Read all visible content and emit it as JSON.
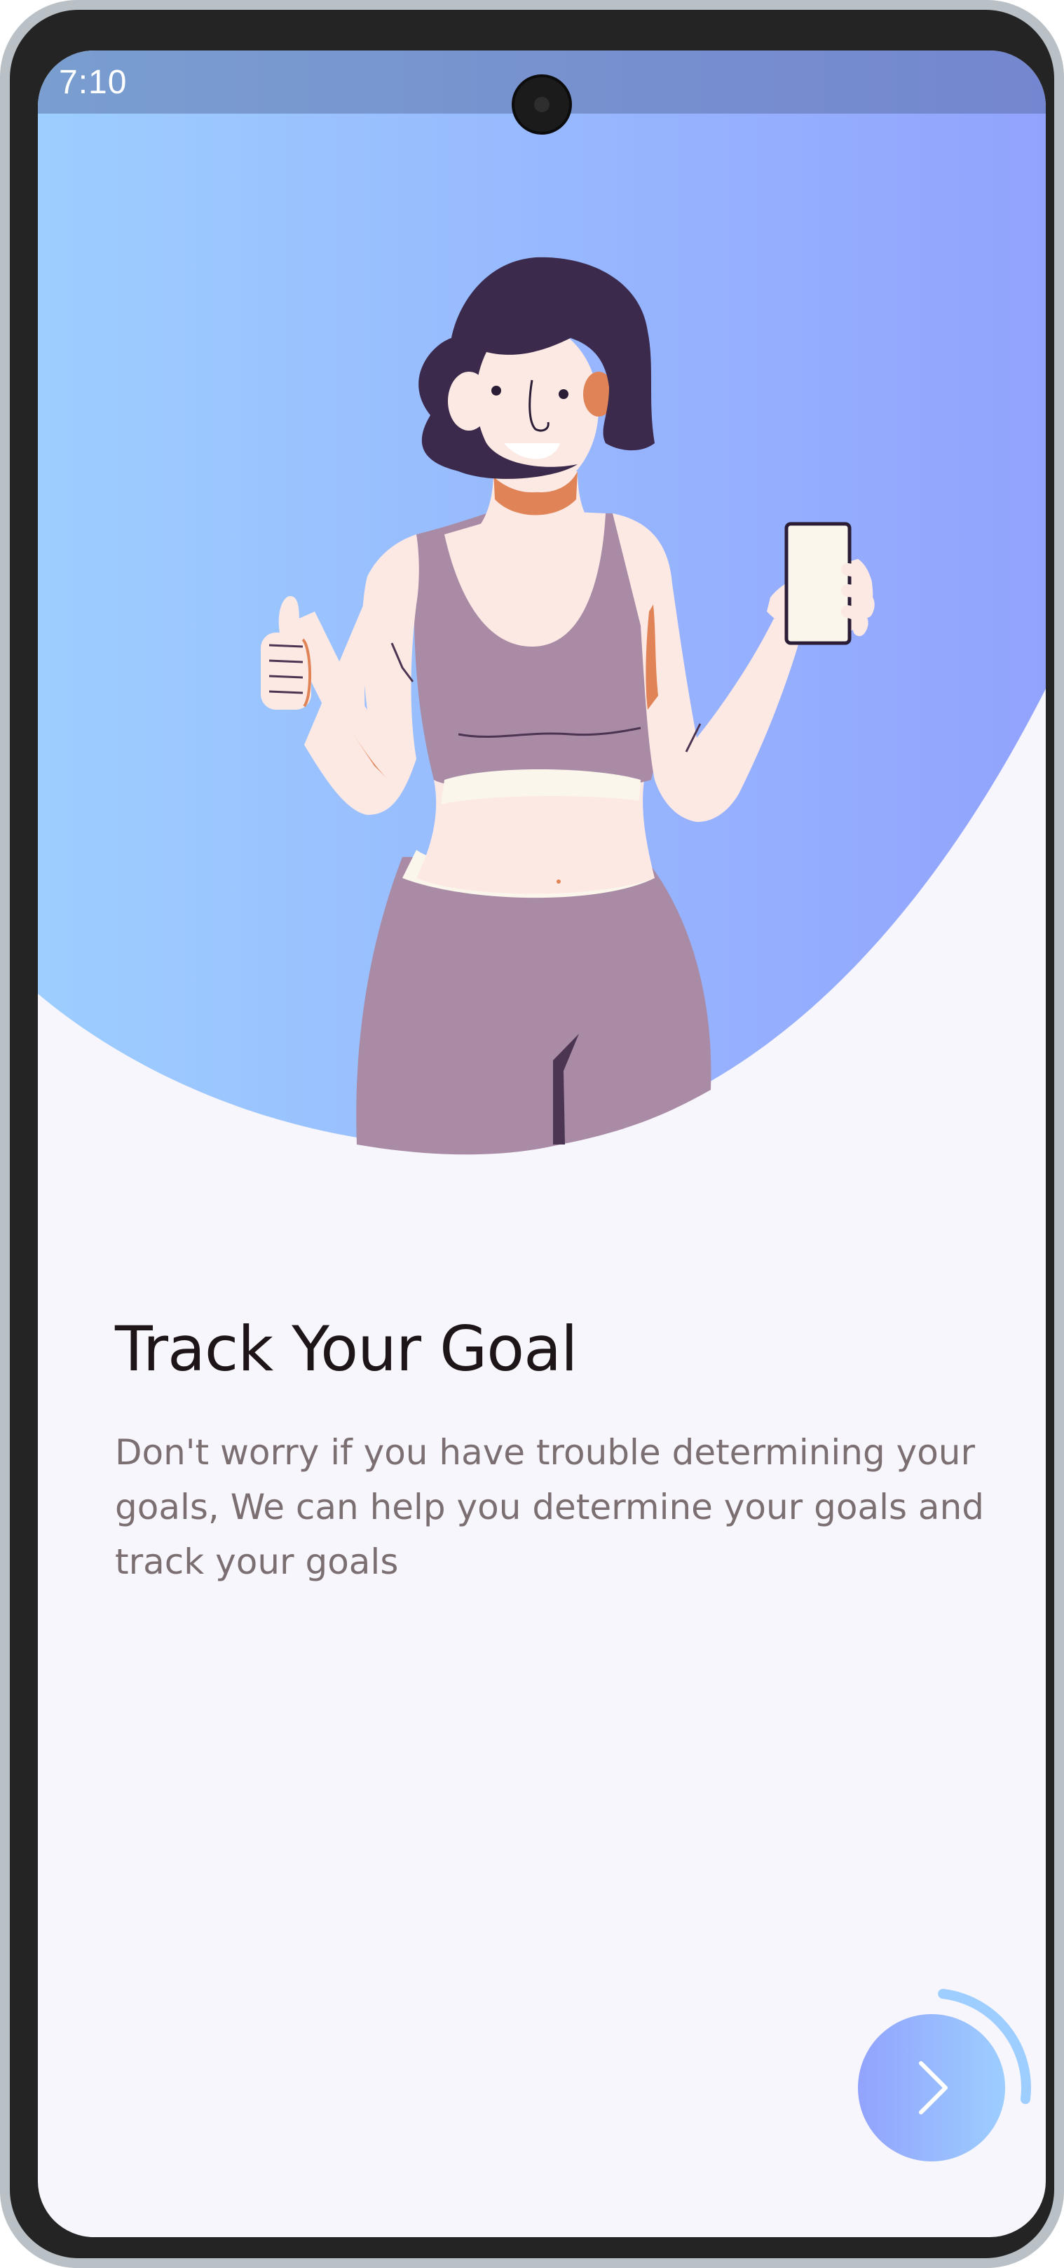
{
  "status_bar": {
    "time": "7:10"
  },
  "hero": {
    "illustration": "woman-thumbs-up-holding-phone",
    "gradient": [
      "#9dceff",
      "#92a3fd"
    ]
  },
  "onboarding": {
    "title": "Track Your Goal",
    "description": "Don't worry if you have trouble determining your goals, We can help you determine your goals and track your goals"
  },
  "next_button": {
    "icon": "chevron-right-icon",
    "progress": 0.25,
    "colors": [
      "#92a3fd",
      "#9dceff"
    ]
  }
}
